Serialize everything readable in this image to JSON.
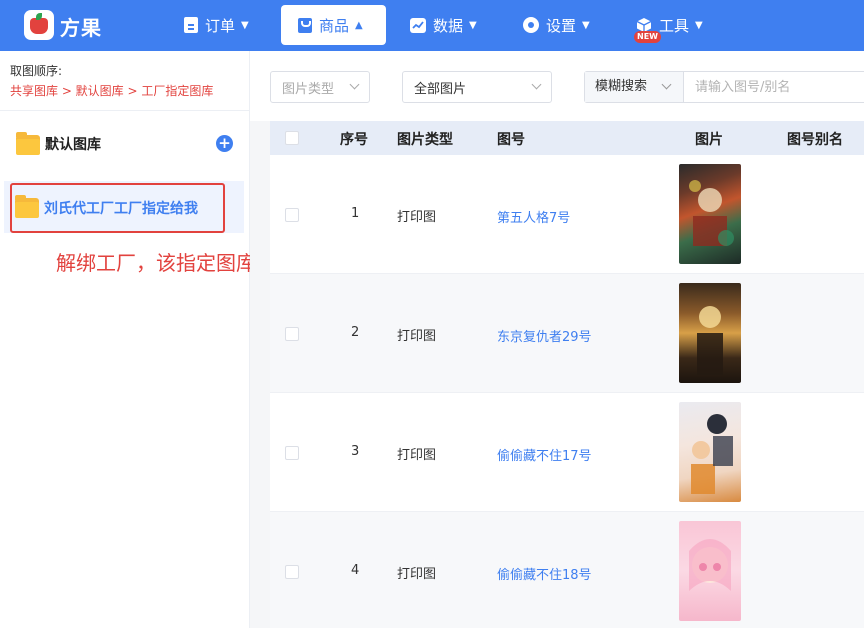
{
  "app": {
    "brand": "方果"
  },
  "nav": {
    "orders": "订单",
    "products": "商品",
    "data": "数据",
    "settings": "设置",
    "tools": "工具",
    "tools_badge": "NEW"
  },
  "sidebar": {
    "order_label": "取图顺序:",
    "order_path": "共享图库 > 默认图库 > 工厂指定图库",
    "libraries": [
      {
        "label": "默认图库"
      },
      {
        "label": "刘氏代工厂工厂指定给我"
      }
    ],
    "annotation": "解绑工厂，该指定图库会对应清除"
  },
  "filters": {
    "image_type_placeholder": "图片类型",
    "image_scope": "全部图片",
    "search_mode": "模糊搜索",
    "search_placeholder": "请输入图号/别名"
  },
  "table": {
    "headers": {
      "index": "序号",
      "type": "图片类型",
      "code": "图号",
      "image": "图片",
      "alias": "图号别名"
    },
    "rows": [
      {
        "index": "1",
        "type": "打印图",
        "code": "第五人格7号"
      },
      {
        "index": "2",
        "type": "打印图",
        "code": "东京复仇者29号"
      },
      {
        "index": "3",
        "type": "打印图",
        "code": "偷偷藏不住17号"
      },
      {
        "index": "4",
        "type": "打印图",
        "code": "偷偷藏不住18号"
      }
    ]
  },
  "colors": {
    "primary": "#3f7ff0",
    "alert": "#e2423e",
    "folder": "#f6b93b"
  }
}
